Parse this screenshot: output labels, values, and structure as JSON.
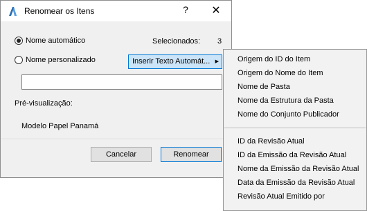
{
  "dialog": {
    "title": "Renomear os Itens",
    "help": "?",
    "close": "✕",
    "auto_name_label": "Nome automático",
    "selected_label": "Selecionados:",
    "selected_count": "3",
    "custom_name_label": "Nome personalizado",
    "insert_button_label": "Inserir Texto Automát...",
    "name_input_value": "",
    "preview_label": "Pré-visualização:",
    "preview_value": "Modelo Papel Panamá",
    "cancel_label": "Cancelar",
    "rename_label": "Renomear",
    "auto_name_selected": true
  },
  "menu": {
    "group1": [
      "Origem do ID do Item",
      "Origem do Nome do Item",
      "Nome de Pasta",
      "Nome da Estrutura da Pasta",
      "Nome do Conjunto Publicador"
    ],
    "group2": [
      "ID da Revisão Atual",
      "ID da Emissão da Revisão Atual",
      "Nome da Emissão da Revisão Atual",
      "Data da Emissão da Revisão Atual",
      "Revisão Atual Emitido por"
    ]
  },
  "colors": {
    "accent": "#0078d7",
    "highlight": "#cce4f7"
  }
}
